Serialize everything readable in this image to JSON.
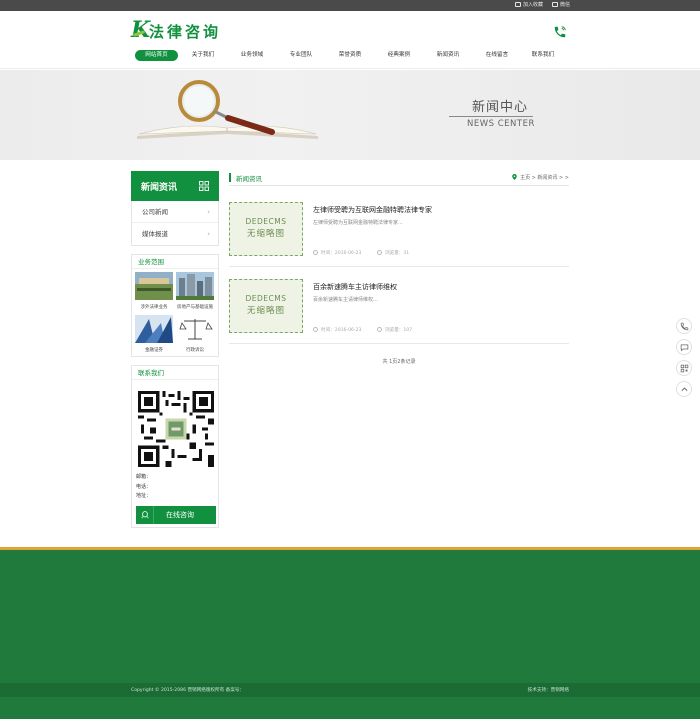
{
  "topbar": {
    "fav_label": "加入收藏",
    "wechat_label": "微信"
  },
  "header": {
    "logo_letter": "K",
    "logo_text": "法律咨询"
  },
  "nav": {
    "items": [
      "网站首页",
      "关于我们",
      "业务领域",
      "专业团队",
      "荣誉资质",
      "经典案例",
      "新闻资讯",
      "在线留言",
      "联系我们"
    ],
    "active_index": 0
  },
  "banner": {
    "title_cn": "新闻中心",
    "title_en": "NEWS CENTER"
  },
  "sidebar": {
    "title": "新闻资讯",
    "items": [
      "公司新闻",
      "媒体报道"
    ],
    "business": {
      "title": "业务范围",
      "items": [
        "涉外法律业务",
        "房地产与基础设施",
        "金融证券",
        "行政诉讼"
      ]
    },
    "contact": {
      "title": "联系我们",
      "email_label": "邮箱：",
      "phone_label": "电话：",
      "address_label": "地址：",
      "consult_label": "在线咨询"
    }
  },
  "content": {
    "section_title": "新闻资讯",
    "breadcrumb": "主页 > 新闻资讯 > >",
    "thumb_line1": "DEDECMS",
    "thumb_line2": "无缩略图",
    "news": [
      {
        "title": "左律师受聘为互联网金融特聘法律专家",
        "desc": "左律师受聘为互联网金融特聘法律专家...",
        "time": "时间：2016-06-23",
        "views": "浏览量：31"
      },
      {
        "title": "百余新速腾车主访律师维权",
        "desc": "百余新速腾车主请律师维权...",
        "time": "时间：2016-06-23",
        "views": "浏览量：107"
      }
    ],
    "pager": "共 1页2条记录"
  },
  "footer": {
    "copyright": "Copyright © 2015-2086 营销网络版权所有   备案号：",
    "tech": "技术支持：营销网络"
  },
  "colors": {
    "brand_green": "#11913f",
    "footer_green": "#1f7a3c",
    "accent_orange": "#e0a13a"
  }
}
